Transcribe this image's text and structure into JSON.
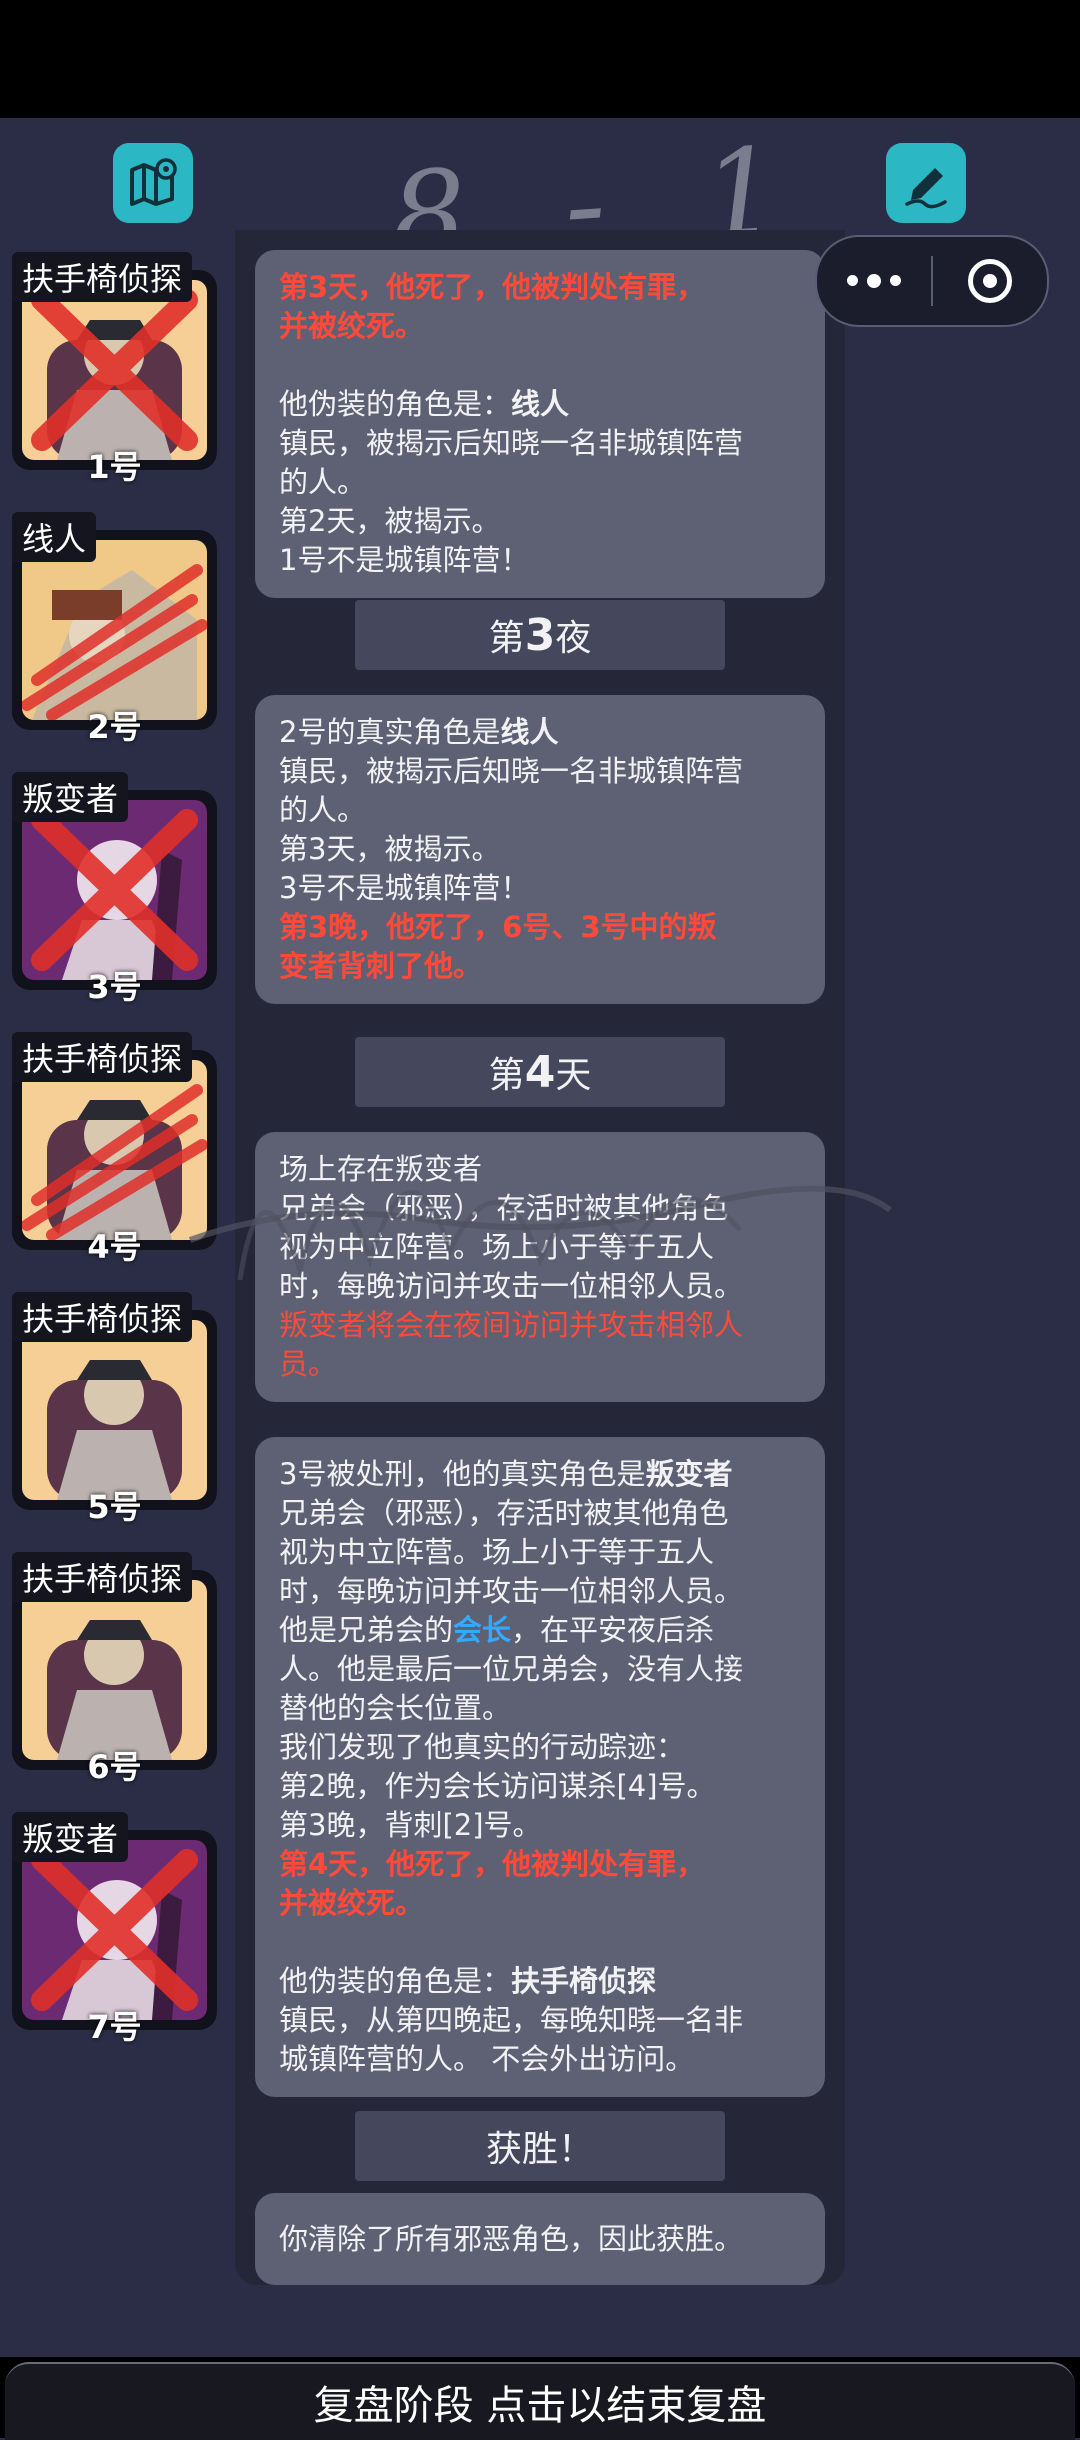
{
  "annotation": "8 - 1",
  "players": [
    {
      "role": "扶手椅侦探",
      "number": "1号",
      "status": "dead"
    },
    {
      "role": "线人",
      "number": "2号",
      "status": "attacked"
    },
    {
      "role": "叛变者",
      "number": "3号",
      "status": "dead"
    },
    {
      "role": "扶手椅侦探",
      "number": "4号",
      "status": "attacked"
    },
    {
      "role": "扶手椅侦探",
      "number": "5号",
      "status": "alive"
    },
    {
      "role": "扶手椅侦探",
      "number": "6号",
      "status": "alive"
    },
    {
      "role": "叛变者",
      "number": "7号",
      "status": "dead"
    }
  ],
  "log": {
    "card1": {
      "line1": "第3天，他死了，他被判处有罪，",
      "line2": "并被绞死。",
      "line3_prefix": "他伪装的角色是：",
      "line3_role": "线人",
      "line4": "镇民，被揭示后知晓一名非城镇阵营",
      "line5": "的人。",
      "line6": "第2天，被揭示。",
      "line7": "1号不是城镇阵营！"
    },
    "header1": {
      "prefix": "第",
      "num": "3",
      "suffix": "夜"
    },
    "card2": {
      "line1_prefix": "2号的真实角色是",
      "line1_role": "线人",
      "line2": "镇民，被揭示后知晓一名非城镇阵营",
      "line3": "的人。",
      "line4": "第3天，被揭示。",
      "line5": "3号不是城镇阵营！",
      "line6": "第3晚，他死了，6号、3号中的叛",
      "line7": "变者背刺了他。"
    },
    "header2": {
      "prefix": "第",
      "num": "4",
      "suffix": "天"
    },
    "card3": {
      "line1": "场上存在叛变者",
      "line2": "兄弟会（邪恶），存活时被其他角色",
      "line3": "视为中立阵营。场上小于等于五人",
      "line4": "时，每晚访问并攻击一位相邻人员。",
      "line5": "叛变者将会在夜间访问并攻击相邻人",
      "line6": "员。"
    },
    "card4": {
      "line1_prefix": "3号被处刑，他的真实角色是",
      "line1_role": "叛变者",
      "line2": "兄弟会（邪恶），存活时被其他角色",
      "line3": "视为中立阵营。场上小于等于五人",
      "line4": "时，每晚访问并攻击一位相邻人员。",
      "line5_prefix": "他是兄弟会的",
      "line5_link": "会长",
      "line5_suffix": "，在平安夜后杀",
      "line6": "人。他是最后一位兄弟会，没有人接",
      "line7": "替他的会长位置。",
      "line8": "我们发现了他真实的行动踪迹：",
      "line9": "第2晚，作为会长访问谋杀[4]号。",
      "line10": "第3晚，背刺[2]号。",
      "line11": "第4天，他死了，他被判处有罪，",
      "line12": "并被绞死。",
      "line13_prefix": "他伪装的角色是：",
      "line13_role": "扶手椅侦探",
      "line14": "镇民，从第四晚起，每晚知晓一名非",
      "line15": "城镇阵营的人。 不会外出访问。"
    },
    "header3": {
      "label": "获胜！"
    },
    "card5": {
      "line1": "你清除了所有邪恶角色，因此获胜。"
    }
  },
  "bottom_button": "复盘阶段 点击以结束复盘",
  "colors": {
    "accent": "#2bb7c4",
    "red": "#ff4a3a",
    "link": "#35a8ff",
    "card": "#5e6174"
  }
}
